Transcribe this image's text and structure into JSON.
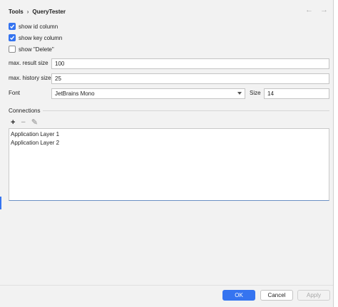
{
  "header": {
    "breadcrumb_root": "Tools",
    "breadcrumb_separator": "›",
    "breadcrumb_current": "QueryTester",
    "back_glyph": "←",
    "forward_glyph": "→"
  },
  "options": {
    "show_id_column": {
      "label": "show id column",
      "checked": true
    },
    "show_key_column": {
      "label": "show key column",
      "checked": true
    },
    "show_delete": {
      "label": "show \"Delete\"",
      "checked": false
    }
  },
  "fields": {
    "max_result_size": {
      "label": "max. result size",
      "value": "100"
    },
    "max_history_size": {
      "label": "max. history size",
      "value": "25"
    },
    "font": {
      "label": "Font",
      "value": "JetBrains Mono"
    },
    "size": {
      "label": "Size",
      "value": "14"
    }
  },
  "connections": {
    "title": "Connections",
    "toolbar": {
      "add": "+",
      "remove": "−",
      "edit": "✎"
    },
    "items": [
      "Application Layer 1",
      "Application Layer 2"
    ]
  },
  "buttons": {
    "ok": "OK",
    "cancel": "Cancel",
    "apply": "Apply"
  },
  "colors": {
    "accent": "#3574f0",
    "disabled_text": "#a8a8a8"
  }
}
